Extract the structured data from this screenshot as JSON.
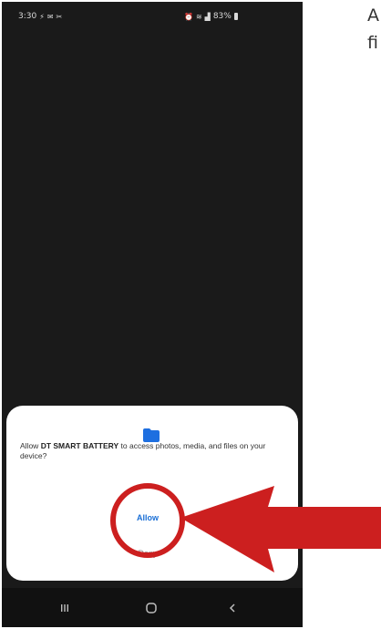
{
  "status_bar": {
    "time": "3:30",
    "battery": "83%"
  },
  "dialog": {
    "message_prefix": "Allow ",
    "app_name": "DT SMART BATTERY",
    "message_suffix": " to access photos, media, and files on your device?",
    "allow_label": "Allow",
    "deny_label": "Deny"
  },
  "side_text": {
    "line1": "A",
    "line2": "fi"
  },
  "colors": {
    "screen_background": "#1a1a1a",
    "accent": "#1a6fd6",
    "annotation_red": "#cc1f1f"
  },
  "icons": [
    "lightning-icon",
    "wifi-icon",
    "alarm-icon",
    "signal-icon",
    "battery-icon",
    "folder-icon",
    "recents-icon",
    "home-icon",
    "back-icon"
  ]
}
